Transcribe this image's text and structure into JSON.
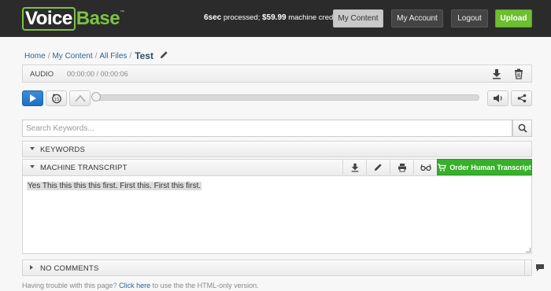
{
  "header": {
    "logo_voice": "Voice",
    "logo_base": "Base",
    "logo_tm": "™",
    "credits_time": "6sec",
    "credits_processed": " processed; ",
    "credits_amount": "$59.99",
    "credits_suffix": " machine credits",
    "nav": {
      "my_content": "My Content",
      "my_account": "My Account",
      "logout": "Logout",
      "upload": "Upload"
    }
  },
  "breadcrumb": {
    "home": "Home",
    "my_content": "My Content",
    "all_files": "All Files",
    "current": "Test",
    "separator": "/"
  },
  "audio": {
    "label": "AUDIO",
    "time": "00:00:00 / 00:00:06",
    "progress": 0
  },
  "search": {
    "placeholder": "Search Keywords..."
  },
  "keywords": {
    "title": "KEYWORDS"
  },
  "transcript": {
    "title": "MACHINE TRANSCRIPT",
    "order_label": "Order Human Transcript",
    "text": "Yes This this this this first. First this. First this first."
  },
  "comments": {
    "title": "NO COMMENTS"
  },
  "footer": {
    "prefix": "Having trouble with this page? ",
    "link": "Click here",
    "suffix": " to use the the HTML-only version."
  },
  "colors": {
    "header_bg": "#2b2b2b",
    "brand_green": "#7cc242",
    "upload_green": "#6cbf2e",
    "order_green": "#37b02b",
    "play_blue": "#1e6fc1",
    "link_blue": "#2a6496"
  }
}
